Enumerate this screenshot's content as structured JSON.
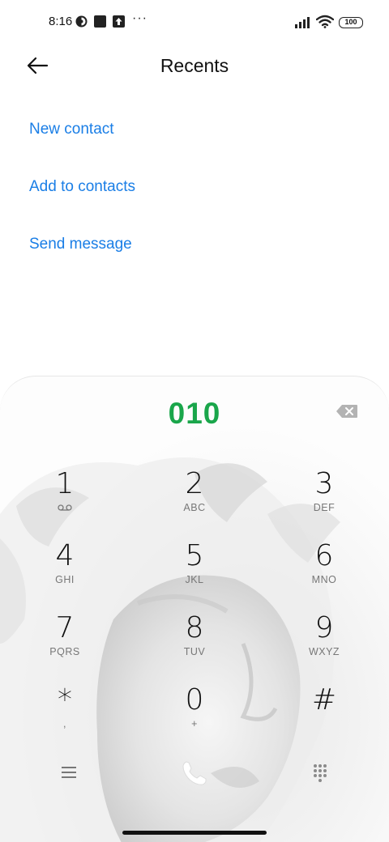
{
  "status_bar": {
    "time": "8:16",
    "dots": "···",
    "battery": "100"
  },
  "header": {
    "title": "Recents",
    "back_icon": "arrow-left-icon"
  },
  "actions": [
    {
      "label": "New contact"
    },
    {
      "label": "Add to contacts"
    },
    {
      "label": "Send message"
    }
  ],
  "dialer": {
    "number": "010",
    "keys": [
      {
        "digit": "1",
        "letters": ""
      },
      {
        "digit": "2",
        "letters": "ABC"
      },
      {
        "digit": "3",
        "letters": "DEF"
      },
      {
        "digit": "4",
        "letters": "GHI"
      },
      {
        "digit": "5",
        "letters": "JKL"
      },
      {
        "digit": "6",
        "letters": "MNO"
      },
      {
        "digit": "7",
        "letters": "PQRS"
      },
      {
        "digit": "8",
        "letters": "TUV"
      },
      {
        "digit": "9",
        "letters": "WXYZ"
      },
      {
        "digit": "*",
        "letters": ","
      },
      {
        "digit": "0",
        "letters": "+"
      },
      {
        "digit": "#",
        "letters": ""
      }
    ]
  },
  "colors": {
    "accent_link": "#1a7ee6",
    "number_green": "#1aa64b"
  }
}
